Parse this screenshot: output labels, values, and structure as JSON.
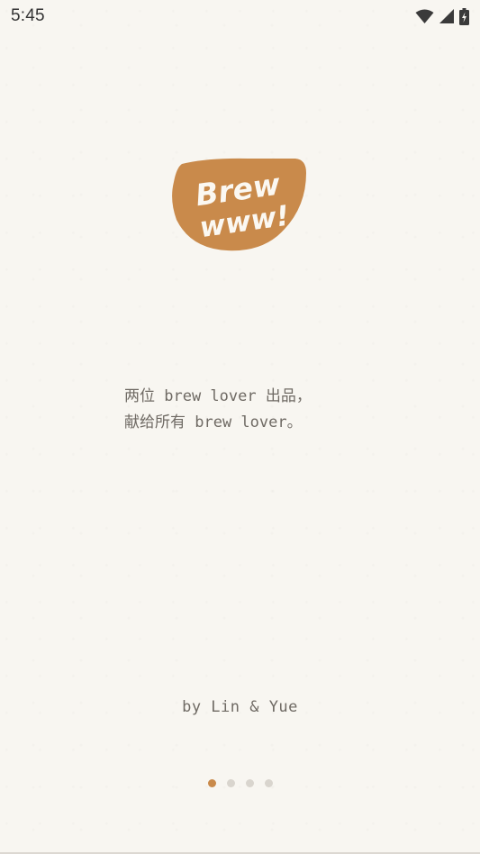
{
  "status_bar": {
    "time": "5:45",
    "icons": [
      "wifi-icon",
      "cellular-signal-icon",
      "battery-charging-icon"
    ]
  },
  "logo": {
    "line1": "Brew",
    "line2": "www!",
    "color": "#c98a4b"
  },
  "tagline": {
    "line1": "两位 brew lover 出品，",
    "line2": "献给所有 brew lover。"
  },
  "credit": "by Lin & Yue",
  "pager": {
    "total": 4,
    "active_index": 0,
    "active_color": "#c98a4b",
    "inactive_color": "#d9d5ce"
  }
}
